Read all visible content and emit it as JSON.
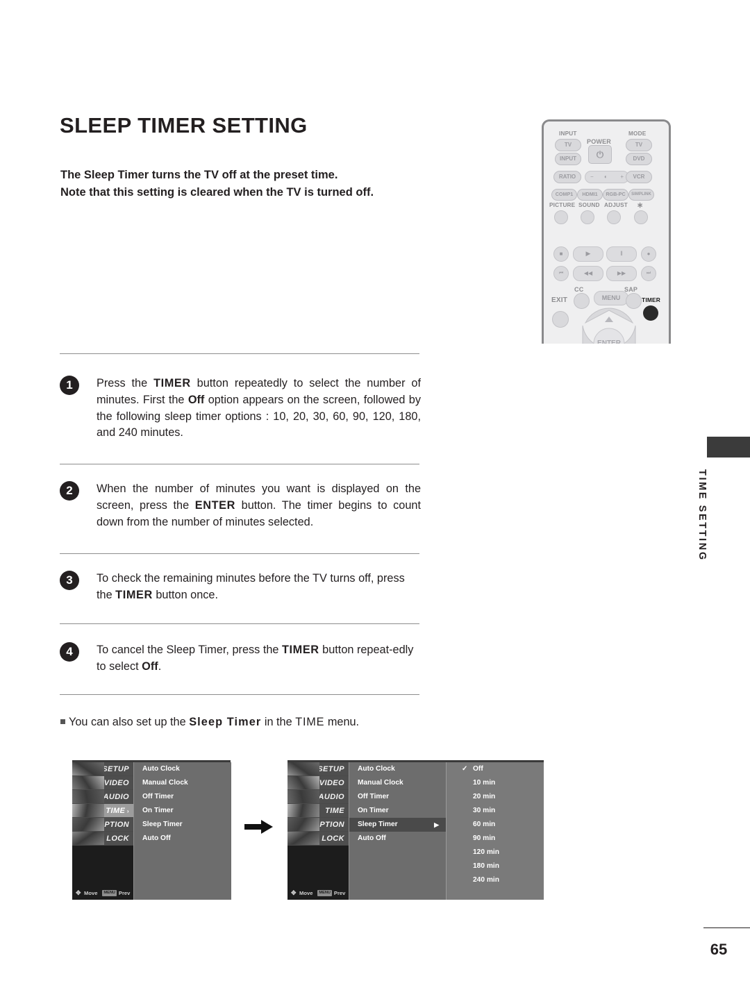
{
  "page": {
    "title": "SLEEP TIMER SETTING",
    "number": "65",
    "side_tab": "TIME SETTING"
  },
  "intro": {
    "line1": "The Sleep Timer turns the TV off at the preset time.",
    "line2": "Note that this setting is cleared when the TV is turned off."
  },
  "steps": [
    {
      "num": "1",
      "parts": [
        {
          "t": "Press the ",
          "s": "n"
        },
        {
          "t": "TIMER",
          "s": "bl"
        },
        {
          "t": " button repeatedly to select the number of minutes. First the ",
          "s": "n"
        },
        {
          "t": "Off",
          "s": "b"
        },
        {
          "t": " option appears on the screen, followed by the following sleep timer options : 10, 20, 30, 60, 90, 120, 180, and 240 minutes.",
          "s": "n"
        }
      ]
    },
    {
      "num": "2",
      "parts": [
        {
          "t": "When the number of minutes you want is displayed on the screen, press the ",
          "s": "n"
        },
        {
          "t": "ENTER",
          "s": "bl"
        },
        {
          "t": " button. The timer begins to count down from the number of minutes selected.",
          "s": "n"
        }
      ]
    },
    {
      "num": "3",
      "parts": [
        {
          "t": "To check the remaining minutes before the TV turns off, press the ",
          "s": "n"
        },
        {
          "t": "TIMER",
          "s": "bl"
        },
        {
          "t": " button once.",
          "s": "n"
        }
      ]
    },
    {
      "num": "4",
      "parts": [
        {
          "t": "To cancel the Sleep Timer, press the ",
          "s": "n"
        },
        {
          "t": "TIMER",
          "s": "bl"
        },
        {
          "t": " button repeat-edly to select ",
          "s": "n"
        },
        {
          "t": "Off",
          "s": "b"
        },
        {
          "t": ".",
          "s": "n"
        }
      ]
    }
  ],
  "note": {
    "pre": "You can also set up the ",
    "emph": "Sleep Timer",
    "mid": " in the ",
    "menu": "TIME",
    "post": " menu."
  },
  "remote": {
    "labels": {
      "input": "INPUT",
      "mode": "MODE",
      "power": "POWER",
      "picture": "PICTURE",
      "sound": "SOUND",
      "adjust": "ADJUST",
      "star": "∗",
      "cc": "CC",
      "sap": "SAP",
      "exit": "EXIT",
      "timer": "TIMER"
    },
    "buttons": {
      "tv_left": "TV",
      "tv_right": "TV",
      "input": "INPUT",
      "dvd": "DVD",
      "ratio": "RATIO",
      "vcr": "VCR",
      "comp1": "COMP1",
      "hdmi1": "HDMI1",
      "rgbpc": "RGB-PC",
      "simplink": "SIMPLINK",
      "menu": "MENU",
      "enter": "ENTER",
      "vol_minus": "−",
      "vol_plus": "+",
      "vol_icon": "◐",
      "stop": "■",
      "play": "▶",
      "pause": "‖",
      "record": "●",
      "prev": "⏮",
      "rew": "◀◀",
      "ff": "▶▶",
      "next": "⏭",
      "power_icon": "⏻",
      "up_arrow": "▲"
    }
  },
  "osd_menu_1": {
    "categories": [
      {
        "label": "SETUP",
        "selected": false
      },
      {
        "label": "VIDEO",
        "selected": false
      },
      {
        "label": "AUDIO",
        "selected": false
      },
      {
        "label": "TIME",
        "selected": true,
        "arrow": "›"
      },
      {
        "label": "OPTION",
        "selected": false
      },
      {
        "label": "LOCK",
        "selected": false
      }
    ],
    "items": [
      {
        "label": "Auto Clock",
        "active": false
      },
      {
        "label": "Manual Clock",
        "active": false
      },
      {
        "label": "Off Timer",
        "active": false
      },
      {
        "label": "On Timer",
        "active": false
      },
      {
        "label": "Sleep Timer",
        "active": false
      },
      {
        "label": "Auto Off",
        "active": false
      }
    ],
    "footer": {
      "move": "Move",
      "prev": "Prev",
      "prev_key": "MENU",
      "move_icon": "✥"
    }
  },
  "osd_menu_2": {
    "categories": [
      {
        "label": "SETUP",
        "selected": false
      },
      {
        "label": "VIDEO",
        "selected": false
      },
      {
        "label": "AUDIO",
        "selected": false
      },
      {
        "label": "TIME",
        "selected": false
      },
      {
        "label": "OPTION",
        "selected": false
      },
      {
        "label": "LOCK",
        "selected": false
      }
    ],
    "items": [
      {
        "label": "Auto Clock",
        "active": false
      },
      {
        "label": "Manual Clock",
        "active": false
      },
      {
        "label": "Off Timer",
        "active": false
      },
      {
        "label": "On Timer",
        "active": false
      },
      {
        "label": "Sleep Timer",
        "active": true,
        "arrow": "▶"
      },
      {
        "label": "Auto Off",
        "active": false
      }
    ],
    "options": [
      {
        "label": "Off",
        "checked": true
      },
      {
        "label": "10 min",
        "checked": false
      },
      {
        "label": "20 min",
        "checked": false
      },
      {
        "label": "30 min",
        "checked": false
      },
      {
        "label": "60 min",
        "checked": false
      },
      {
        "label": "90 min",
        "checked": false
      },
      {
        "label": "120 min",
        "checked": false
      },
      {
        "label": "180 min",
        "checked": false
      },
      {
        "label": "240 min",
        "checked": false
      }
    ],
    "check_glyph": "✓",
    "footer": {
      "move": "Move",
      "prev": "Prev",
      "prev_key": "MENU",
      "move_icon": "✥"
    }
  }
}
